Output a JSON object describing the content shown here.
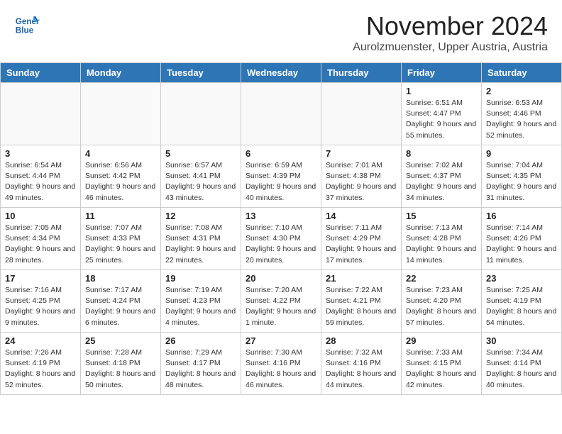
{
  "header": {
    "logo_line1": "General",
    "logo_line2": "Blue",
    "month": "November 2024",
    "location": "Aurolzmuenster, Upper Austria, Austria"
  },
  "weekdays": [
    "Sunday",
    "Monday",
    "Tuesday",
    "Wednesday",
    "Thursday",
    "Friday",
    "Saturday"
  ],
  "weeks": [
    [
      {
        "day": "",
        "info": ""
      },
      {
        "day": "",
        "info": ""
      },
      {
        "day": "",
        "info": ""
      },
      {
        "day": "",
        "info": ""
      },
      {
        "day": "",
        "info": ""
      },
      {
        "day": "1",
        "info": "Sunrise: 6:51 AM\nSunset: 4:47 PM\nDaylight: 9 hours and 55 minutes."
      },
      {
        "day": "2",
        "info": "Sunrise: 6:53 AM\nSunset: 4:46 PM\nDaylight: 9 hours and 52 minutes."
      }
    ],
    [
      {
        "day": "3",
        "info": "Sunrise: 6:54 AM\nSunset: 4:44 PM\nDaylight: 9 hours and 49 minutes."
      },
      {
        "day": "4",
        "info": "Sunrise: 6:56 AM\nSunset: 4:42 PM\nDaylight: 9 hours and 46 minutes."
      },
      {
        "day": "5",
        "info": "Sunrise: 6:57 AM\nSunset: 4:41 PM\nDaylight: 9 hours and 43 minutes."
      },
      {
        "day": "6",
        "info": "Sunrise: 6:59 AM\nSunset: 4:39 PM\nDaylight: 9 hours and 40 minutes."
      },
      {
        "day": "7",
        "info": "Sunrise: 7:01 AM\nSunset: 4:38 PM\nDaylight: 9 hours and 37 minutes."
      },
      {
        "day": "8",
        "info": "Sunrise: 7:02 AM\nSunset: 4:37 PM\nDaylight: 9 hours and 34 minutes."
      },
      {
        "day": "9",
        "info": "Sunrise: 7:04 AM\nSunset: 4:35 PM\nDaylight: 9 hours and 31 minutes."
      }
    ],
    [
      {
        "day": "10",
        "info": "Sunrise: 7:05 AM\nSunset: 4:34 PM\nDaylight: 9 hours and 28 minutes."
      },
      {
        "day": "11",
        "info": "Sunrise: 7:07 AM\nSunset: 4:33 PM\nDaylight: 9 hours and 25 minutes."
      },
      {
        "day": "12",
        "info": "Sunrise: 7:08 AM\nSunset: 4:31 PM\nDaylight: 9 hours and 22 minutes."
      },
      {
        "day": "13",
        "info": "Sunrise: 7:10 AM\nSunset: 4:30 PM\nDaylight: 9 hours and 20 minutes."
      },
      {
        "day": "14",
        "info": "Sunrise: 7:11 AM\nSunset: 4:29 PM\nDaylight: 9 hours and 17 minutes."
      },
      {
        "day": "15",
        "info": "Sunrise: 7:13 AM\nSunset: 4:28 PM\nDaylight: 9 hours and 14 minutes."
      },
      {
        "day": "16",
        "info": "Sunrise: 7:14 AM\nSunset: 4:26 PM\nDaylight: 9 hours and 11 minutes."
      }
    ],
    [
      {
        "day": "17",
        "info": "Sunrise: 7:16 AM\nSunset: 4:25 PM\nDaylight: 9 hours and 9 minutes."
      },
      {
        "day": "18",
        "info": "Sunrise: 7:17 AM\nSunset: 4:24 PM\nDaylight: 9 hours and 6 minutes."
      },
      {
        "day": "19",
        "info": "Sunrise: 7:19 AM\nSunset: 4:23 PM\nDaylight: 9 hours and 4 minutes."
      },
      {
        "day": "20",
        "info": "Sunrise: 7:20 AM\nSunset: 4:22 PM\nDaylight: 9 hours and 1 minute."
      },
      {
        "day": "21",
        "info": "Sunrise: 7:22 AM\nSunset: 4:21 PM\nDaylight: 8 hours and 59 minutes."
      },
      {
        "day": "22",
        "info": "Sunrise: 7:23 AM\nSunset: 4:20 PM\nDaylight: 8 hours and 57 minutes."
      },
      {
        "day": "23",
        "info": "Sunrise: 7:25 AM\nSunset: 4:19 PM\nDaylight: 8 hours and 54 minutes."
      }
    ],
    [
      {
        "day": "24",
        "info": "Sunrise: 7:26 AM\nSunset: 4:19 PM\nDaylight: 8 hours and 52 minutes."
      },
      {
        "day": "25",
        "info": "Sunrise: 7:28 AM\nSunset: 4:18 PM\nDaylight: 8 hours and 50 minutes."
      },
      {
        "day": "26",
        "info": "Sunrise: 7:29 AM\nSunset: 4:17 PM\nDaylight: 8 hours and 48 minutes."
      },
      {
        "day": "27",
        "info": "Sunrise: 7:30 AM\nSunset: 4:16 PM\nDaylight: 8 hours and 46 minutes."
      },
      {
        "day": "28",
        "info": "Sunrise: 7:32 AM\nSunset: 4:16 PM\nDaylight: 8 hours and 44 minutes."
      },
      {
        "day": "29",
        "info": "Sunrise: 7:33 AM\nSunset: 4:15 PM\nDaylight: 8 hours and 42 minutes."
      },
      {
        "day": "30",
        "info": "Sunrise: 7:34 AM\nSunset: 4:14 PM\nDaylight: 8 hours and 40 minutes."
      }
    ]
  ]
}
